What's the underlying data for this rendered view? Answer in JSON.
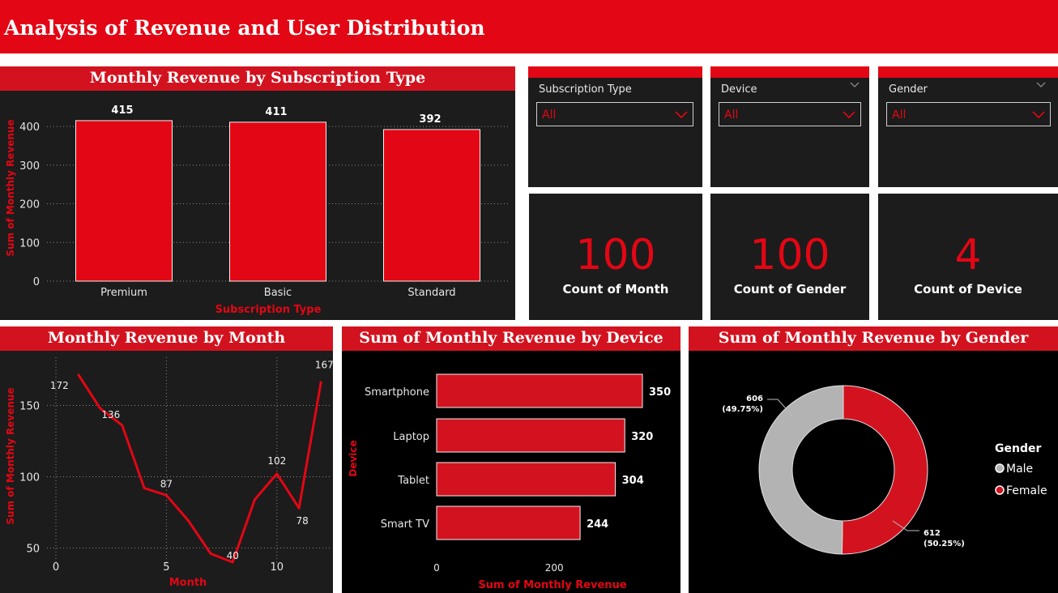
{
  "header": {
    "title": "Analysis of Revenue and User Distribution"
  },
  "slicers": [
    {
      "label": "Subscription Type",
      "value": "All"
    },
    {
      "label": "Device",
      "value": "All"
    },
    {
      "label": "Gender",
      "value": "All"
    }
  ],
  "cards": [
    {
      "value": "100",
      "label": "Count of Month"
    },
    {
      "value": "100",
      "label": "Count of Gender"
    },
    {
      "value": "4",
      "label": "Count of Device"
    }
  ],
  "colors": {
    "accent": "#e30614",
    "panel": "#1c1c1c",
    "female": "#d3121f",
    "male": "#b3b3b3"
  },
  "chart_data": [
    {
      "type": "bar",
      "title": "Monthly Revenue by Subscription Type",
      "xlabel": "Subscription Type",
      "ylabel": "Sum of Monthly Revenue",
      "categories": [
        "Premium",
        "Basic",
        "Standard"
      ],
      "values": [
        415,
        411,
        392
      ],
      "ylim": [
        0,
        440
      ],
      "yticks": [
        0,
        100,
        200,
        300,
        400
      ],
      "grid": true
    },
    {
      "type": "line",
      "title": "Monthly Revenue by Month",
      "xlabel": "Month",
      "ylabel": "Sum of Monthly Revenue",
      "x": [
        1,
        2,
        3,
        4,
        5,
        6,
        7,
        8,
        9,
        10,
        11,
        12
      ],
      "values": [
        172,
        148,
        136,
        92,
        87,
        69,
        46,
        40,
        84,
        102,
        78,
        167
      ],
      "data_labels": [
        {
          "x": 1,
          "label": "172"
        },
        {
          "x": 3,
          "label": "136"
        },
        {
          "x": 5,
          "label": "87"
        },
        {
          "x": 8,
          "label": "40"
        },
        {
          "x": 10,
          "label": "102"
        },
        {
          "x": 11,
          "label": "78"
        },
        {
          "x": 12,
          "label": "167"
        }
      ],
      "xlim": [
        0,
        12.5
      ],
      "ylim": [
        40,
        177
      ],
      "xticks": [
        0,
        5,
        10
      ],
      "yticks": [
        50,
        100,
        150
      ],
      "grid": true
    },
    {
      "type": "bar",
      "orientation": "horizontal",
      "title": "Sum of Monthly Revenue by Device",
      "xlabel": "Sum of Monthly Revenue",
      "ylabel": "Device",
      "categories": [
        "Smartphone",
        "Laptop",
        "Tablet",
        "Smart TV"
      ],
      "values": [
        350,
        320,
        304,
        244
      ],
      "xlim": [
        0,
        350
      ],
      "xticks": [
        0,
        200
      ]
    },
    {
      "type": "pie",
      "title": "Sum of Monthly Revenue by Gender",
      "legend_title": "Gender",
      "legend_position": "right",
      "categories": [
        "Male",
        "Female"
      ],
      "values": [
        606,
        612
      ],
      "labels": [
        {
          "value": "606",
          "pct": "(49.75%)"
        },
        {
          "value": "612",
          "pct": "(50.25%)"
        }
      ],
      "donut": true
    }
  ]
}
